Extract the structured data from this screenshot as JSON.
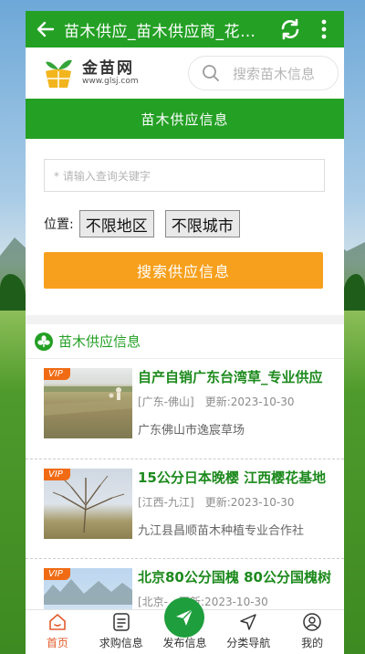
{
  "topbar": {
    "title": "苗木供应_苗木供应商_花卉苗木供应信息"
  },
  "logo": {
    "name": "金苗网",
    "url": "www.glsj.com"
  },
  "search": {
    "placeholder": "搜索苗木信息"
  },
  "section": {
    "title": "苗木供应信息"
  },
  "form": {
    "keyword_placeholder": "* 请输入查询关键字",
    "location_label": "位置:",
    "region_select": "不限地区",
    "city_select": "不限城市",
    "search_button": "搜索供应信息"
  },
  "list": {
    "heading": "苗木供应信息",
    "items": [
      {
        "badge": "VIP",
        "title": "自产自销广东台湾草_专业供应",
        "location": "[广东-佛山]",
        "updated": "更新:2023-10-30",
        "company": "广东佛山市逸宸草场"
      },
      {
        "badge": "VIP",
        "title": "15公分日本晚樱 江西樱花基地",
        "location": "[江西-九江]",
        "updated": "更新:2023-10-30",
        "company": "九江县昌顺苗木种植专业合作社"
      },
      {
        "badge": "VIP",
        "title": "北京80公分国槐 80公分国槐树",
        "location": "[北京-",
        "updated": "更新:2023-10-30",
        "company": ""
      }
    ]
  },
  "tabbar": {
    "home": "首页",
    "purchase": "求购信息",
    "publish": "发布信息",
    "category": "分类导航",
    "mine": "我的"
  },
  "colors": {
    "brand_green": "#24a025",
    "accent_orange": "#f7a01d",
    "active_tab": "#e35b2b",
    "vip_badge": "#f06b14"
  }
}
